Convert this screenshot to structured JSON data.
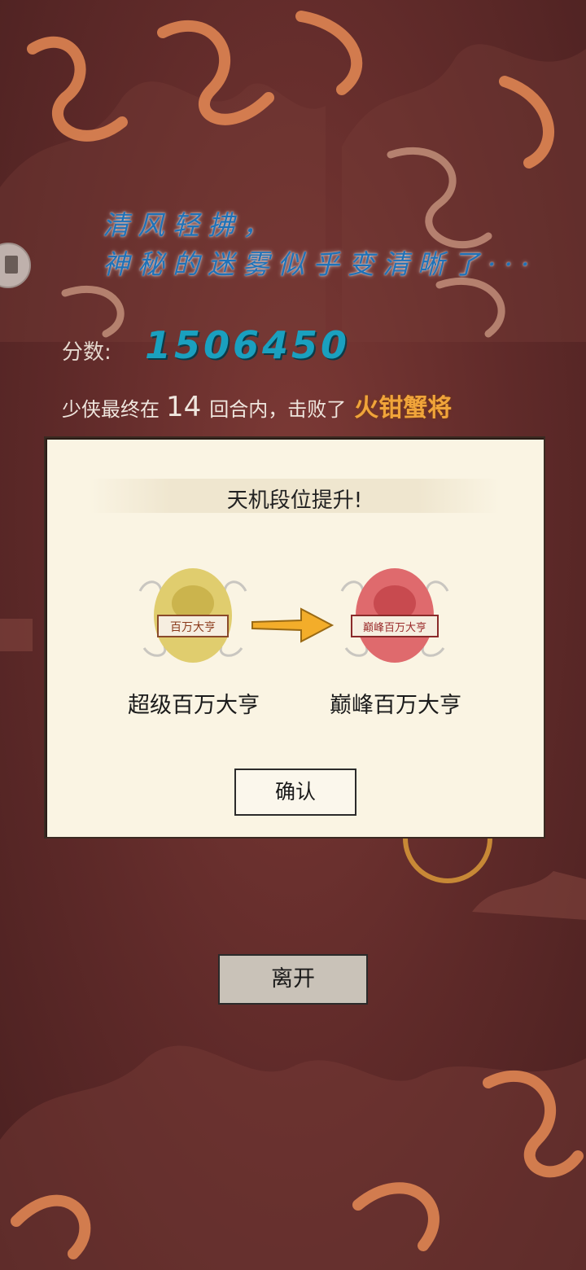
{
  "header": {
    "poem_line1": "清风轻拂，",
    "poem_line2": "神秘的迷雾似乎变清晰了···"
  },
  "score": {
    "label": "分数:",
    "value": "1506450"
  },
  "result": {
    "prefix": "少侠最终在",
    "rounds": "14",
    "middle": "回合内，击败了",
    "boss_name": "火钳蟹将"
  },
  "dialog": {
    "title": "天机段位提升!",
    "old_rank": {
      "name": "超级百万大亨",
      "badge_text": "百万大亨",
      "color": "#d8c36a"
    },
    "new_rank": {
      "name": "巅峰百万大亨",
      "badge_text": "巅峰百万大亨",
      "color": "#d6585c"
    },
    "confirm_label": "确认"
  },
  "footer": {
    "leave_label": "离开"
  },
  "colors": {
    "background": "#5e2a2a",
    "poem_text": "#1f72b8",
    "score_text": "#1aa0bf",
    "boss_text": "#f0a43a",
    "dialog_bg": "#faf4e3"
  },
  "icons": {
    "floating_button": "bookmark-icon",
    "rank_arrow": "arrow-right-icon"
  }
}
